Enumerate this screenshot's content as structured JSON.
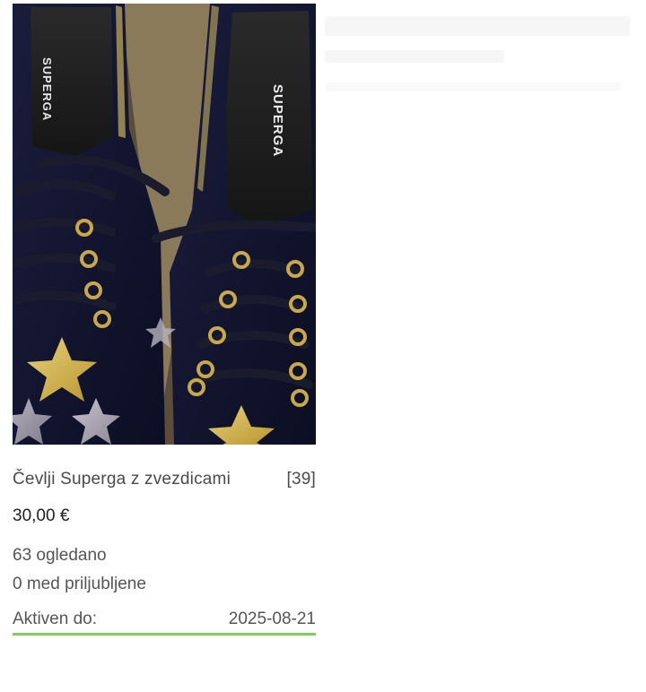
{
  "listing": {
    "title": "Čevlji Superga z zvezdicami",
    "size": "[39]",
    "price": "30,00 €",
    "views": "63 ogledano",
    "favorites": "0 med priljubljene",
    "active_label": "Aktiven do:",
    "active_date": "2025-08-21",
    "photo": {
      "brand_left": "SUPERGA",
      "brand_right": "SUPERGA"
    }
  },
  "colors": {
    "accent_underline": "#7dd05a",
    "text_primary": "#1f1f1f",
    "text_secondary": "#555555"
  }
}
